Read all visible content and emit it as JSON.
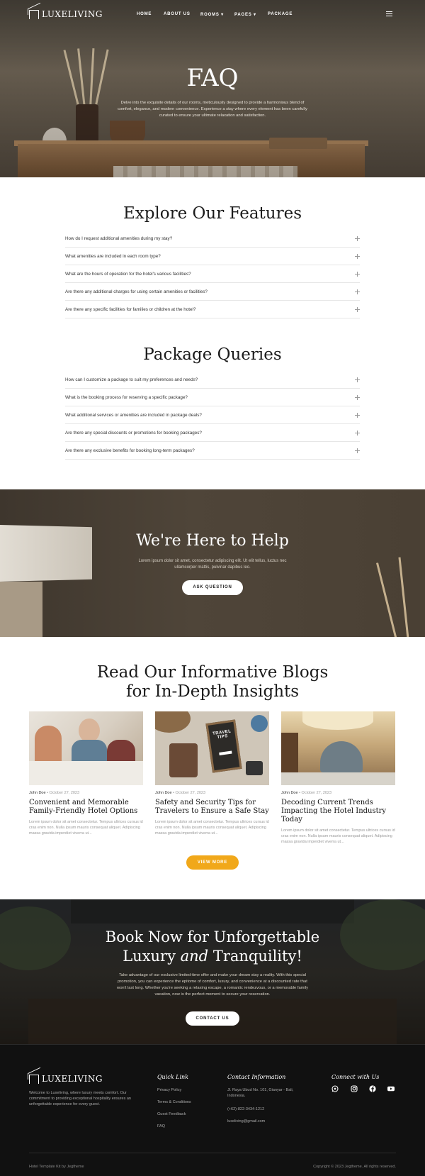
{
  "brand": {
    "name": "LUXELIVING"
  },
  "nav": {
    "items": [
      "HOME",
      "ABOUT US",
      "ROOMS ▾",
      "PAGES ▾",
      "PACKAGE"
    ],
    "menu_icon": "hamburger-icon"
  },
  "hero": {
    "title": "FAQ",
    "description": "Delve into the exquisite details of our rooms, meticulously designed to provide a harmonious blend of comfort, elegance, and modern convenience. Experience a stay where every element has been carefully curated to ensure your ultimate relaxation and satisfaction."
  },
  "features": {
    "title": "Explore Our Features",
    "questions": [
      "How do I request additional amenities during my stay?",
      "What amenities are included in each room type?",
      "What are the hours of operation for the hotel's various facilities?",
      "Are there any additional charges for using certain amenities or facilities?",
      "Are there any specific facilities for families or children at the hotel?"
    ]
  },
  "packages": {
    "title": "Package Queries",
    "questions": [
      "How can I customize a package to suit my preferences and needs?",
      "What is the booking process for reserving a specific package?",
      "What additional services or amenities are included in package deals?",
      "Are there any special discounts or promotions for booking packages?",
      "Are there any exclusive benefits for booking long-term packages?"
    ]
  },
  "help": {
    "title": "We're Here to Help",
    "text": "Lorem ipsum dolor sit amet, consectetur adipiscing elit. Ut elit tellus, luctus nec ullamcorper mattis, pulvinar dapibus leo.",
    "button": "ASK QUESTION"
  },
  "blogs": {
    "title_line1": "Read Our Informative Blogs",
    "title_line2": "for In-Depth Insights",
    "posts": [
      {
        "author": "John Doe",
        "date": "October 27, 2023",
        "title": "Convenient and Memorable Family-Friendly Hotel Options",
        "excerpt": "Lorem ipsum dolor sit amet consectetur. Tempus ultrices cursus id cras enim non. Nulla ipsum mauris consequat aliquet. Adipiscing massa gravida imperdiet viverra ut..."
      },
      {
        "author": "John Doe",
        "date": "October 27, 2023",
        "title": "Safety and Security Tips for Travelers to Ensure a Safe Stay",
        "excerpt": "Lorem ipsum dolor sit amet consectetur. Tempus ultrices cursus id cras enim non. Nulla ipsum mauris consequat aliquet. Adipiscing massa gravida imperdiet viverra ut..."
      },
      {
        "author": "John Doe",
        "date": "October 27, 2023",
        "title": "Decoding Current Trends Impacting the Hotel Industry Today",
        "excerpt": "Lorem ipsum dolor sit amet consectetur. Tempus ultrices cursus id cras enim non. Nulla ipsum mauris consequat aliquet. Adipiscing massa gravida imperdiet viverra ut..."
      }
    ],
    "travel_tips_line1": "TRAVEL",
    "travel_tips_line2": "TIPS",
    "button": "VIEW MORE"
  },
  "book": {
    "title_line1": "Book Now for Unforgettable",
    "title_line2_a": "Luxury ",
    "title_line2_em": "and",
    "title_line2_b": " Tranquility!",
    "text": "Take advantage of our exclusive limited-time offer and make your dream stay a reality. With this special promotion, you can experience the epitome of comfort, luxury, and convenience at a discounted rate that won't last long. Whether you're seeking a relaxing escape, a romantic rendezvous, or a memorable family vacation, now is the perfect moment to secure your reservation.",
    "button": "CONTACT US"
  },
  "footer": {
    "about": "Welcome to Luxeliving, where luxury meets comfort. Our commitment to providing exceptional hospitality ensures an unforgettable experience for every guest.",
    "quick_link": {
      "heading": "Quick Link",
      "links": [
        "Privacy Policy",
        "Terms & Conditions",
        "Guest Feedback",
        "FAQ"
      ]
    },
    "contact": {
      "heading": "Contact Information",
      "address": "Jl. Raya Ubud No. 101, Gianyar - Bali, Indonesia.",
      "phone": "(+62)-822-3434-1212",
      "email": "luxeliving@gmail.com"
    },
    "connect": {
      "heading": "Connect with Us",
      "icons": [
        "whatsapp-icon",
        "instagram-icon",
        "facebook-icon",
        "youtube-icon"
      ]
    },
    "credit": "Hotel Template Kit by Jegtheme",
    "copyright": "Copyright © 2023 Jegtheme. All rights reserved."
  },
  "colors": {
    "accent": "#f1a81a",
    "footer_bg": "#111111",
    "text_dark": "#1b1b1b"
  }
}
